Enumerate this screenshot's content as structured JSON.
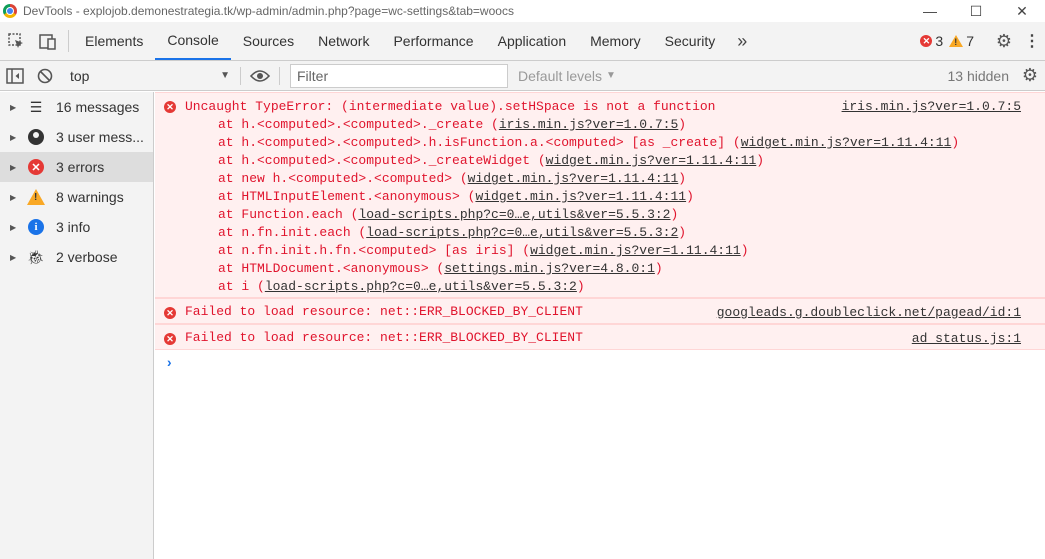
{
  "window": {
    "title": "DevTools - explojob.demonestrategia.tk/wp-admin/admin.php?page=wc-settings&tab=woocs",
    "controls": [
      "—",
      "☐",
      "✕"
    ]
  },
  "tabs": {
    "items": [
      "Elements",
      "Console",
      "Sources",
      "Network",
      "Performance",
      "Application",
      "Memory",
      "Security"
    ],
    "active": "Console",
    "more": "»",
    "error_count": "3",
    "warning_count": "7"
  },
  "console_toolbar": {
    "context": "top",
    "filter_placeholder": "Filter",
    "levels": "Default levels",
    "hidden": "13 hidden"
  },
  "sidebar": {
    "items": [
      {
        "label": "16 messages",
        "icon": "list-icon"
      },
      {
        "label": "3 user mess...",
        "icon": "user-icon"
      },
      {
        "label": "3 errors",
        "icon": "error-icon"
      },
      {
        "label": "8 warnings",
        "icon": "warning-icon"
      },
      {
        "label": "3 info",
        "icon": "info-icon"
      },
      {
        "label": "2 verbose",
        "icon": "bug-icon"
      }
    ],
    "selected": "3 errors"
  },
  "messages": [
    {
      "text": "Uncaught TypeError: (intermediate value).setHSpace is not a function",
      "source": "iris.min.js?ver=1.0.7:5",
      "stack": [
        {
          "pre": "at h.<computed>.<computed>._create (",
          "link": "iris.min.js?ver=1.0.7:5",
          "post": ")"
        },
        {
          "pre": "at h.<computed>.<computed>.h.isFunction.a.<computed> [as _create] (",
          "link": "widget.min.js?ver=1.11.4:11",
          "post": ")"
        },
        {
          "pre": "at h.<computed>.<computed>._createWidget (",
          "link": "widget.min.js?ver=1.11.4:11",
          "post": ")"
        },
        {
          "pre": "at new h.<computed>.<computed> (",
          "link": "widget.min.js?ver=1.11.4:11",
          "post": ")"
        },
        {
          "pre": "at HTMLInputElement.<anonymous> (",
          "link": "widget.min.js?ver=1.11.4:11",
          "post": ")"
        },
        {
          "pre": "at Function.each (",
          "link": "load-scripts.php?c=0…e,utils&ver=5.5.3:2",
          "post": ")"
        },
        {
          "pre": "at n.fn.init.each (",
          "link": "load-scripts.php?c=0…e,utils&ver=5.5.3:2",
          "post": ")"
        },
        {
          "pre": "at n.fn.init.h.fn.<computed> [as iris] (",
          "link": "widget.min.js?ver=1.11.4:11",
          "post": ")"
        },
        {
          "pre": "at HTMLDocument.<anonymous> (",
          "link": "settings.min.js?ver=4.8.0:1",
          "post": ")"
        },
        {
          "pre": "at i (",
          "link": "load-scripts.php?c=0…e,utils&ver=5.5.3:2",
          "post": ")"
        }
      ]
    },
    {
      "text": "Failed to load resource: net::ERR_BLOCKED_BY_CLIENT",
      "source": "googleads.g.doubleclick.net/pagead/id:1"
    },
    {
      "text": "Failed to load resource: net::ERR_BLOCKED_BY_CLIENT",
      "source": "ad_status.js:1"
    }
  ],
  "prompt": "›",
  "colors": {
    "error_text": "#e0142d",
    "error_bg": "#fff0f0",
    "accent": "#1a73e8",
    "warning": "#f9a825"
  }
}
